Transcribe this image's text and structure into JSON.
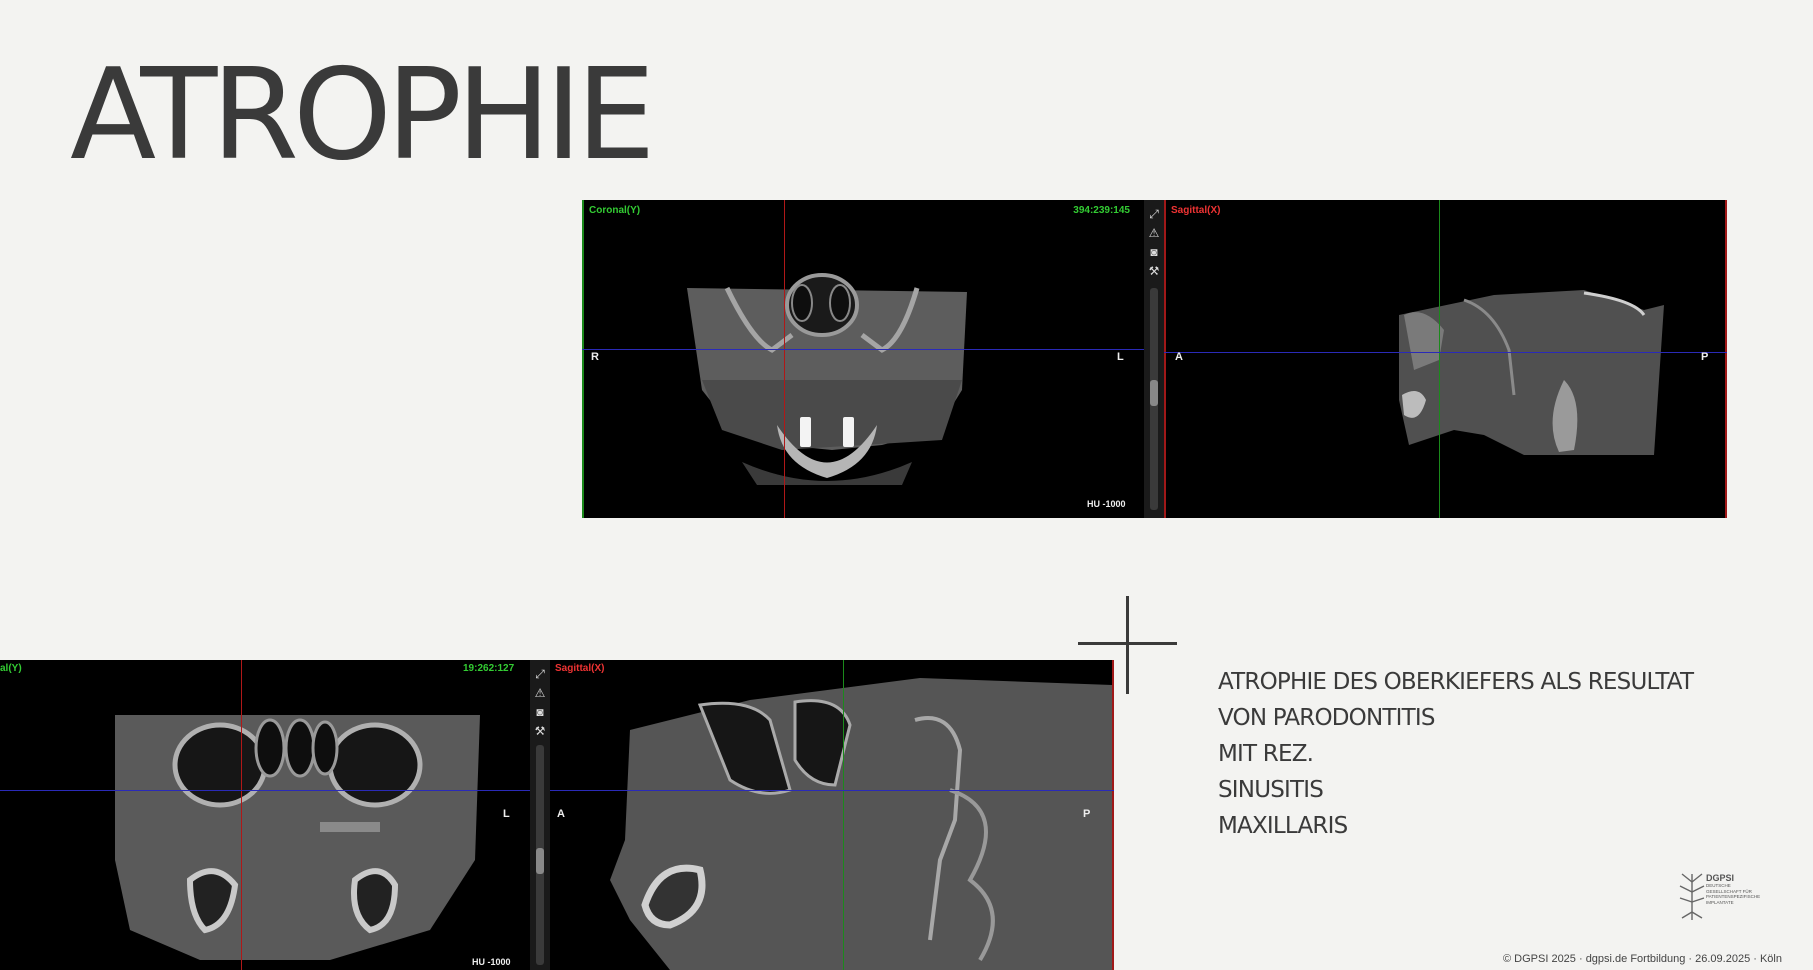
{
  "slide": {
    "title": "ATROPHIE",
    "text_lines": [
      "ATROPHIE DES OBERKIEFERS ALS RESULTAT",
      "VON PARODONTITIS",
      "MIT REZ.",
      "SINUSITIS",
      "MAXILLARIS"
    ],
    "footer": "© DGPSI 2025 · dgpsi.de Fortbildung · 26.09.2025 · Köln"
  },
  "logo": {
    "name": "DGPSI",
    "subtitle_lines": [
      "DEUTSCHE",
      "GESELLSCHAFT FÜR",
      "PATIENTENSPEZIFISCHE",
      "IMPLANTATE"
    ]
  },
  "viewer_top": {
    "coronal_title": "Coronal(Y)",
    "coronal_coords": "394:239:145",
    "coronal_left": "R",
    "coronal_right": "L",
    "coronal_hu": "HU -1000",
    "sagittal_title": "Sagittal(X)",
    "sagittal_left": "A",
    "sagittal_right": "P"
  },
  "viewer_bottom": {
    "coronal_title": "al(Y)",
    "coronal_coords": "19:262:127",
    "coronal_right": "L",
    "coronal_hu": "HU -1000",
    "sagittal_title": "Sagittal(X)",
    "sagittal_left": "A",
    "sagittal_right": "P"
  },
  "toolbar_icons": [
    "expand-icon",
    "warning-icon",
    "camera-icon",
    "wrench-icon"
  ],
  "colors": {
    "background": "#f3f3f1",
    "text": "#3a3a3a",
    "viewer_bg": "#000000",
    "label_green": "#33cc33",
    "label_red": "#ee3333",
    "crosshair_blue": "#2a2ab8"
  }
}
